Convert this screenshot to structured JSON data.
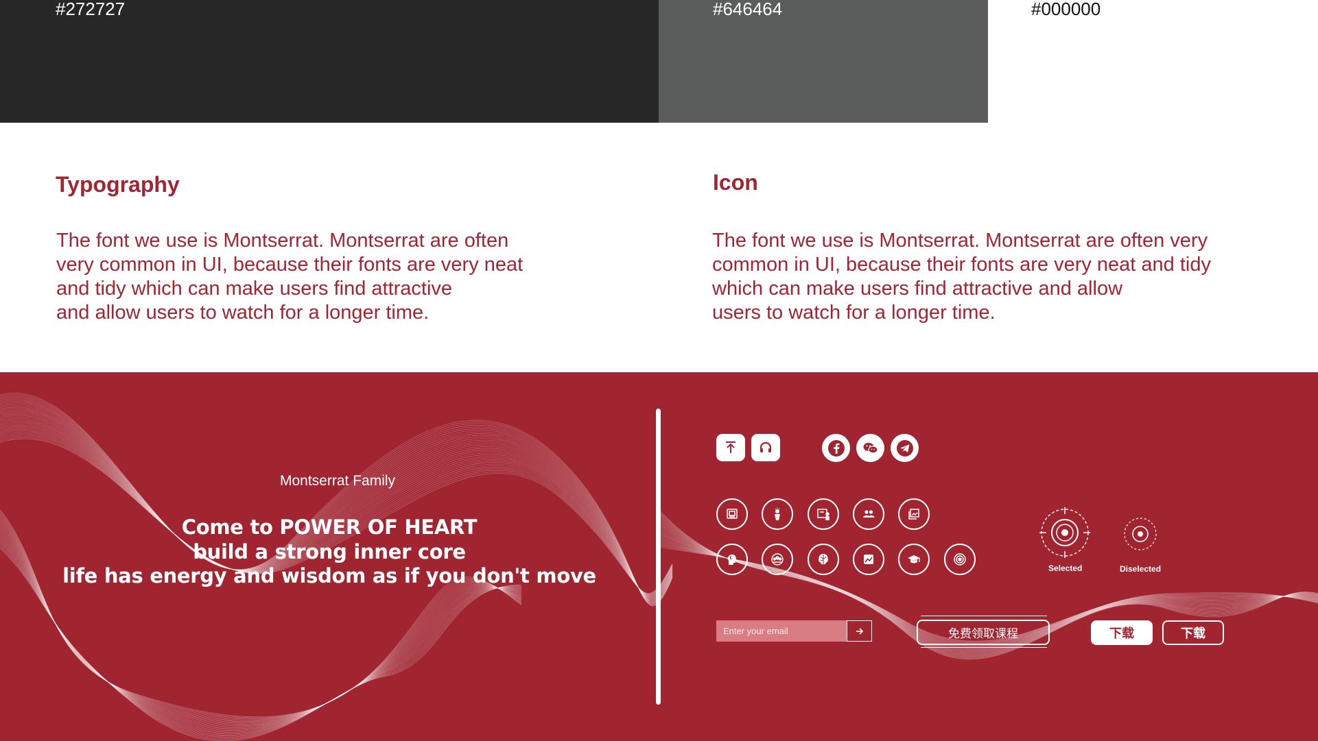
{
  "palette": [
    {
      "label": "#272727",
      "color": "#272727"
    },
    {
      "label": "#646464",
      "color": "#646464"
    },
    {
      "label": "#000000",
      "color": "#000000"
    }
  ],
  "typography": {
    "heading": "Typography",
    "body": "The font we use is Montserrat. Montserrat are often\nvery common in UI, because their fonts are very neat\nand tidy which can make users find attractive\nand allow users to watch for a longer time."
  },
  "icon_section": {
    "heading": "Icon",
    "body": "The font we use is Montserrat. Montserrat are often very\ncommon in UI, because their fonts are very neat and tidy\nwhich can make users find attractive and allow\nusers to watch for a longer time."
  },
  "showcase": {
    "family_label": "Montserrat Family",
    "hero_lines": [
      "Come to POWER OF HEART",
      "build a strong inner core",
      "life has energy and wisdom as if you don't move"
    ],
    "brand_color": "#a02531",
    "top_icons": [
      "upload-icon",
      "headphones-icon"
    ],
    "social_icons": [
      "facebook-icon",
      "wechat-icon",
      "telegram-icon"
    ],
    "ring_icons_row1": [
      "photo-frame-icon",
      "speaker-person-icon",
      "presentation-icon",
      "group-icon",
      "gallery-icon"
    ],
    "ring_icons_row2": [
      "head-profile-icon",
      "team-icon",
      "brain-icon",
      "chart-icon",
      "graduation-cap-icon",
      "target-icon"
    ],
    "state_selected": "Selected",
    "state_deselected": "Diselected",
    "email_placeholder": "Enter your email",
    "course_button": "免费领取课程",
    "download_filled": "下载",
    "download_outline": "下载"
  }
}
